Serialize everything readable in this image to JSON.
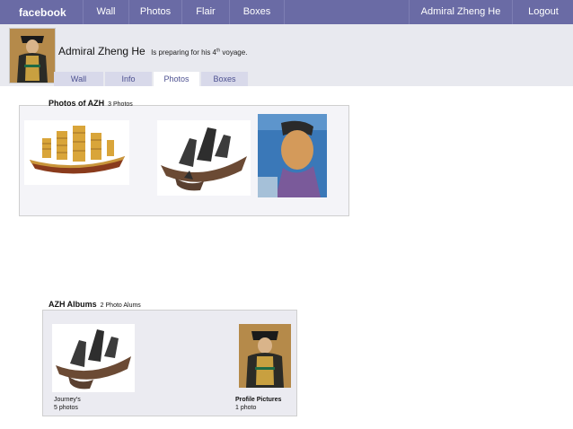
{
  "topbar": {
    "logo": "facebook",
    "nav": [
      "Wall",
      "Photos",
      "Flair",
      "Boxes"
    ],
    "user": "Admiral Zheng He",
    "logout": "Logout"
  },
  "profile": {
    "name": "Admiral Zheng He",
    "status_pre": "Is preparing for his 4",
    "status_sup": "th",
    "status_post": " voyage."
  },
  "tabs": [
    "Wall",
    "Info",
    "Photos",
    "Boxes"
  ],
  "active_tab": "Photos",
  "photos_section": {
    "title": "Photos of AZH",
    "count": "3 Photos"
  },
  "albums_section": {
    "title": "AZH Albums",
    "count": "2 Photo Alums"
  },
  "albums": [
    {
      "name": "Journey's",
      "count": "5 photos"
    },
    {
      "name": "Profile Pictures",
      "count": "1 photo"
    }
  ],
  "colors": {
    "topbar": "#6a6ba5",
    "profilebar": "#e8e9ef",
    "tab": "#d8d9ea",
    "link": "#4c5090"
  }
}
